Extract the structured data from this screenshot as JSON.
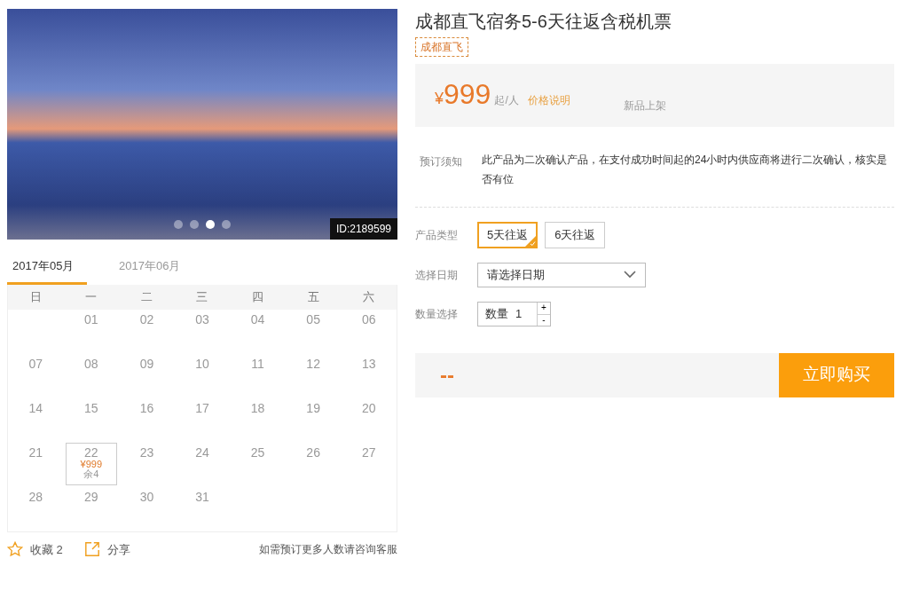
{
  "gallery": {
    "id_label": "ID:2189599",
    "dots": [
      {
        "selected": false
      },
      {
        "selected": false
      },
      {
        "selected": true
      },
      {
        "selected": false
      }
    ]
  },
  "calendar": {
    "tabs": [
      {
        "label": "2017年05月",
        "selected": true
      },
      {
        "label": "2017年06月",
        "selected": false
      }
    ],
    "weekdays": [
      "日",
      "一",
      "二",
      "三",
      "四",
      "五",
      "六"
    ],
    "weeks": [
      [
        {
          "kind": "blank"
        },
        {
          "kind": "day",
          "day": "01"
        },
        {
          "kind": "day",
          "day": "02"
        },
        {
          "kind": "day",
          "day": "03"
        },
        {
          "kind": "day",
          "day": "04"
        },
        {
          "kind": "day",
          "day": "05"
        },
        {
          "kind": "day",
          "day": "06"
        }
      ],
      [
        {
          "kind": "day",
          "day": "07"
        },
        {
          "kind": "day",
          "day": "08"
        },
        {
          "kind": "day",
          "day": "09"
        },
        {
          "kind": "day",
          "day": "10"
        },
        {
          "kind": "day",
          "day": "11"
        },
        {
          "kind": "day",
          "day": "12"
        },
        {
          "kind": "day",
          "day": "13"
        }
      ],
      [
        {
          "kind": "day",
          "day": "14"
        },
        {
          "kind": "day",
          "day": "15"
        },
        {
          "kind": "day",
          "day": "16"
        },
        {
          "kind": "day",
          "day": "17"
        },
        {
          "kind": "day",
          "day": "18"
        },
        {
          "kind": "day",
          "day": "19"
        },
        {
          "kind": "day",
          "day": "20"
        }
      ],
      [
        {
          "kind": "day",
          "day": "21"
        },
        {
          "kind": "day",
          "day": "22",
          "price": "¥999",
          "remaining": "余4"
        },
        {
          "kind": "day",
          "day": "23"
        },
        {
          "kind": "day",
          "day": "24"
        },
        {
          "kind": "day",
          "day": "25"
        },
        {
          "kind": "day",
          "day": "26"
        },
        {
          "kind": "day",
          "day": "27"
        }
      ],
      [
        {
          "kind": "day",
          "day": "28"
        },
        {
          "kind": "day",
          "day": "29"
        },
        {
          "kind": "day",
          "day": "30"
        },
        {
          "kind": "day",
          "day": "31"
        },
        {
          "kind": "blank"
        },
        {
          "kind": "blank"
        },
        {
          "kind": "blank"
        }
      ]
    ]
  },
  "footer": {
    "favorite": "收藏 2",
    "share": "分享",
    "hint": "如需预订更多人数请咨询客服"
  },
  "product": {
    "title": "成都直飞宿务5-6天往返含税机票",
    "tag": "成都直飞",
    "price": {
      "currency": "¥",
      "amount": "999",
      "unit": "起/人",
      "link": "价格说明",
      "note": "新品上架"
    },
    "notice": {
      "label": "预订须知",
      "text": "此产品为二次确认产品，在支付成功时间起的24小时内供应商将进行二次确认，核实是否有位"
    },
    "type": {
      "label": "产品类型",
      "choices": [
        {
          "label": "5天往返",
          "selected": true
        },
        {
          "label": "6天往返",
          "selected": false
        }
      ]
    },
    "date": {
      "label": "选择日期",
      "value": "请选择日期"
    },
    "quantity": {
      "label": "数量选择",
      "prefix": "数量",
      "value": "1",
      "plus": "+",
      "minus": "-"
    },
    "total": "--",
    "buy": "立即购买"
  }
}
